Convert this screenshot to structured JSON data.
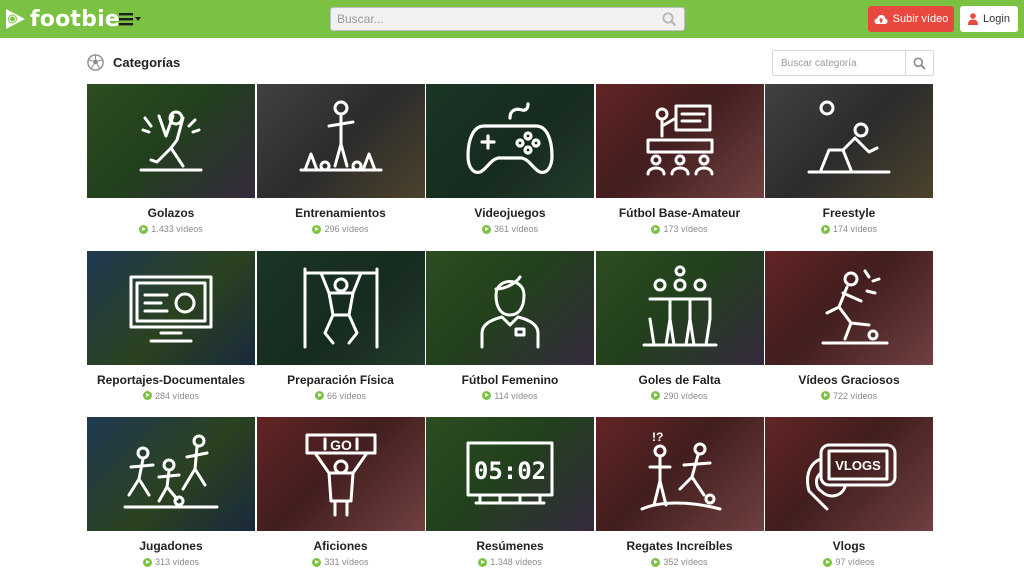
{
  "header": {
    "logo_text": "footbie",
    "search_placeholder": "Buscar...",
    "upload_label": "Subir vídeo",
    "login_label": "Login"
  },
  "section": {
    "title": "Categorías",
    "search_placeholder": "Buscar categoría"
  },
  "colors": {
    "brand_green": "#7cc242",
    "upload_red": "#e8493f"
  },
  "categories": [
    {
      "name": "Golazos",
      "count": "1.433 vídeos",
      "icon": "celebrating-player-icon",
      "bg": "green"
    },
    {
      "name": "Entrenamientos",
      "count": "296 vídeos",
      "icon": "training-cones-icon",
      "bg": "grey"
    },
    {
      "name": "Videojuegos",
      "count": "361 vídeos",
      "icon": "gamepad-icon",
      "bg": "darkgreen"
    },
    {
      "name": "Fútbol Base-Amateur",
      "count": "173 vídeos",
      "icon": "classroom-icon",
      "bg": "red"
    },
    {
      "name": "Freestyle",
      "count": "174 vídeos",
      "icon": "freestyle-player-icon",
      "bg": "grey"
    },
    {
      "name": "Reportajes-Documentales",
      "count": "284 vídeos",
      "icon": "tv-screen-icon",
      "bg": "blue"
    },
    {
      "name": "Preparación Física",
      "count": "66 vídeos",
      "icon": "pullup-athlete-icon",
      "bg": "darkgreen"
    },
    {
      "name": "Fútbol Femenino",
      "count": "114 vídeos",
      "icon": "female-player-icon",
      "bg": "green"
    },
    {
      "name": "Goles de Falta",
      "count": "290 vídeos",
      "icon": "defensive-wall-icon",
      "bg": "green"
    },
    {
      "name": "Vídeos Graciosos",
      "count": "722 vídeos",
      "icon": "funny-fall-icon",
      "bg": "red"
    },
    {
      "name": "Jugadones",
      "count": "313 vídeos",
      "icon": "dribbling-players-icon",
      "bg": "blue"
    },
    {
      "name": "Aficiones",
      "count": "331 vídeos",
      "icon": "fan-with-sign-icon",
      "bg": "red"
    },
    {
      "name": "Resúmenes",
      "count": "1.348 vídeos",
      "icon": "scoreboard-icon",
      "bg": "green",
      "score": "05:02"
    },
    {
      "name": "Regates Increíbles",
      "count": "352 vídeos",
      "icon": "dribble-trick-icon",
      "bg": "red"
    },
    {
      "name": "Vlogs",
      "count": "97 vídeos",
      "icon": "phone-vlog-icon",
      "bg": "red",
      "tag": "VLOGS"
    }
  ]
}
